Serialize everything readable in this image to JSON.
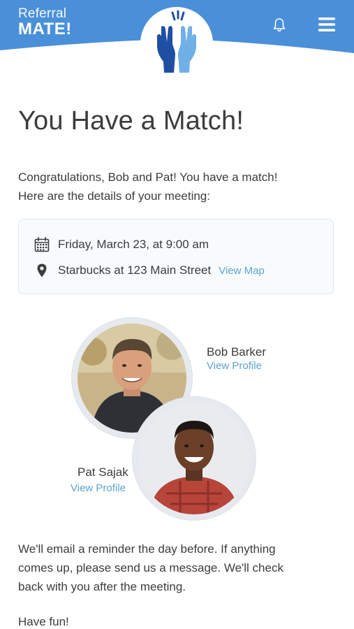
{
  "header": {
    "brand_top": "Referral",
    "brand_bottom": "MATE!",
    "accent": "#4a90d9",
    "emblem_icon": "high-five-hands-icon",
    "notification_icon": "bell-icon",
    "menu_icon": "hamburger-menu-icon"
  },
  "main": {
    "title": "You Have a Match!",
    "intro": "Congratulations, Bob and Pat! You have a match! Here are the details of your meeting:",
    "meeting": {
      "date_icon": "calendar-icon",
      "date_text": "Friday, March 23, at 9:00 am",
      "location_icon": "location-pin-icon",
      "location_text": "Starbucks at 123 Main Street",
      "map_link": "View Map"
    },
    "people": [
      {
        "name": "Bob Barker",
        "link": "View Profile"
      },
      {
        "name": "Pat Sajak",
        "link": "View Profile"
      }
    ],
    "outro": "We'll email a reminder the day before. If anything comes up, please send us a message. We'll check back with you after the meeting.",
    "closing": "Have fun!"
  }
}
